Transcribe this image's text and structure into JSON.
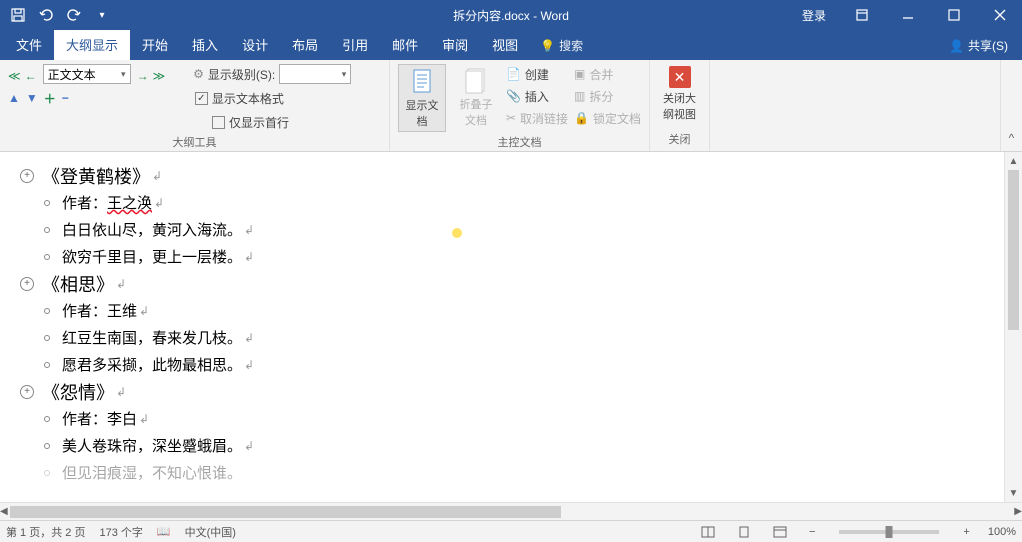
{
  "title": "拆分内容.docx - Word",
  "login": "登录",
  "tabs": {
    "file": "文件",
    "outline": "大纲显示",
    "home": "开始",
    "insert": "插入",
    "design": "设计",
    "layout": "布局",
    "references": "引用",
    "mailings": "邮件",
    "review": "审阅",
    "view": "视图",
    "tell": "搜索"
  },
  "share": "共享(S)",
  "ribbon": {
    "outline_tools": {
      "level_label": "正文文本",
      "show_level_lbl": "显示级别(S):",
      "show_formatting": "显示文本格式",
      "show_firstline": "仅显示首行",
      "group": "大纲工具"
    },
    "master": {
      "show_doc": "显示文档",
      "collapse_sub": "折叠子文档",
      "create": "创建",
      "insert": "插入",
      "unlink": "取消链接",
      "merge": "合并",
      "split": "拆分",
      "lock": "锁定文档",
      "group": "主控文档"
    },
    "close": {
      "close": "关闭大纲视图",
      "group": "关闭"
    }
  },
  "doc": {
    "h1_a": "《登黄鹤楼》",
    "a1": "作者：",
    "a1b": "王之涣",
    "a2": "白日依山尽，黄河入海流。",
    "a3": "欲穷千里目，更上一层楼。",
    "h1_b": "《相思》",
    "b1": "作者：王维",
    "b2": "红豆生南国，春来发几枝。",
    "b3": "愿君多采撷，此物最相思。",
    "h1_c": "《怨情》",
    "c1": "作者：李白",
    "c2": "美人卷珠帘，深坐蹙蛾眉。",
    "c3": "但见泪痕湿，不知心恨谁。"
  },
  "status": {
    "page": "第 1 页，共 2 页",
    "words": "173 个字",
    "lang": "中文(中国)",
    "zoom": "100%"
  }
}
